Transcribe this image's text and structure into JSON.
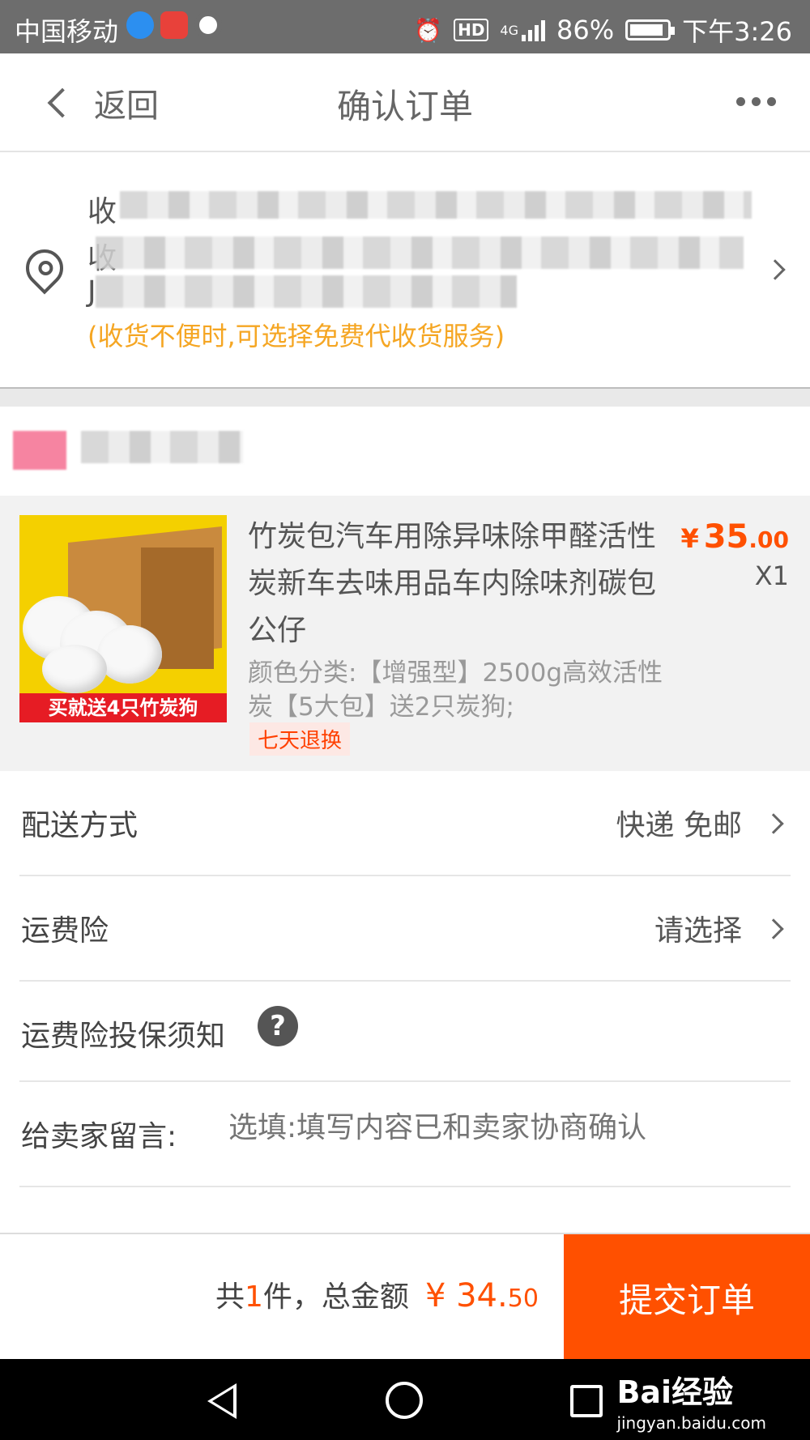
{
  "status_bar": {
    "carrier": "中国移动",
    "network": "4G",
    "hd": "HD",
    "battery": "86%",
    "time": "下午3:26"
  },
  "nav": {
    "back_label": "返回",
    "title": "确认订单"
  },
  "address": {
    "line1_prefix": "收",
    "line2_prefix": "收",
    "line3_prefix": "J",
    "note": "(收货不便时,可选择免费代收货服务)"
  },
  "product": {
    "image_banner": "买就送4只竹炭狗",
    "title": "竹炭包汽车用除异味除甲醛活性炭新车去味用品车内除味剂碳包公仔",
    "price_symbol": "¥",
    "price_int": "35",
    "price_dec": ".00",
    "quantity": "X1",
    "sku": "颜色分类:【增强型】2500g高效活性炭【5大包】送2只炭狗;",
    "tag": "七天退换"
  },
  "rows": {
    "delivery_label": "配送方式",
    "delivery_value": "快递 免邮",
    "insurance_label": "运费险",
    "insurance_value": "请选择",
    "insurance_notice_label": "运费险投保须知",
    "help_glyph": "?",
    "message_label": "给卖家留言:",
    "message_placeholder": "选填:填写内容已和卖家协商确认"
  },
  "bottom": {
    "count_prefix": "共",
    "count": "1",
    "count_suffix": "件，总金额",
    "amount_symbol": "¥",
    "amount_int": "34.",
    "amount_dec": "50",
    "submit_label": "提交订单"
  },
  "watermark": {
    "brand": "Bai经验",
    "sub": "jingyan.baidu.com"
  },
  "colors": {
    "accent": "#ff5000",
    "note": "#f5a623",
    "status_bar": "#6d6d6d"
  }
}
